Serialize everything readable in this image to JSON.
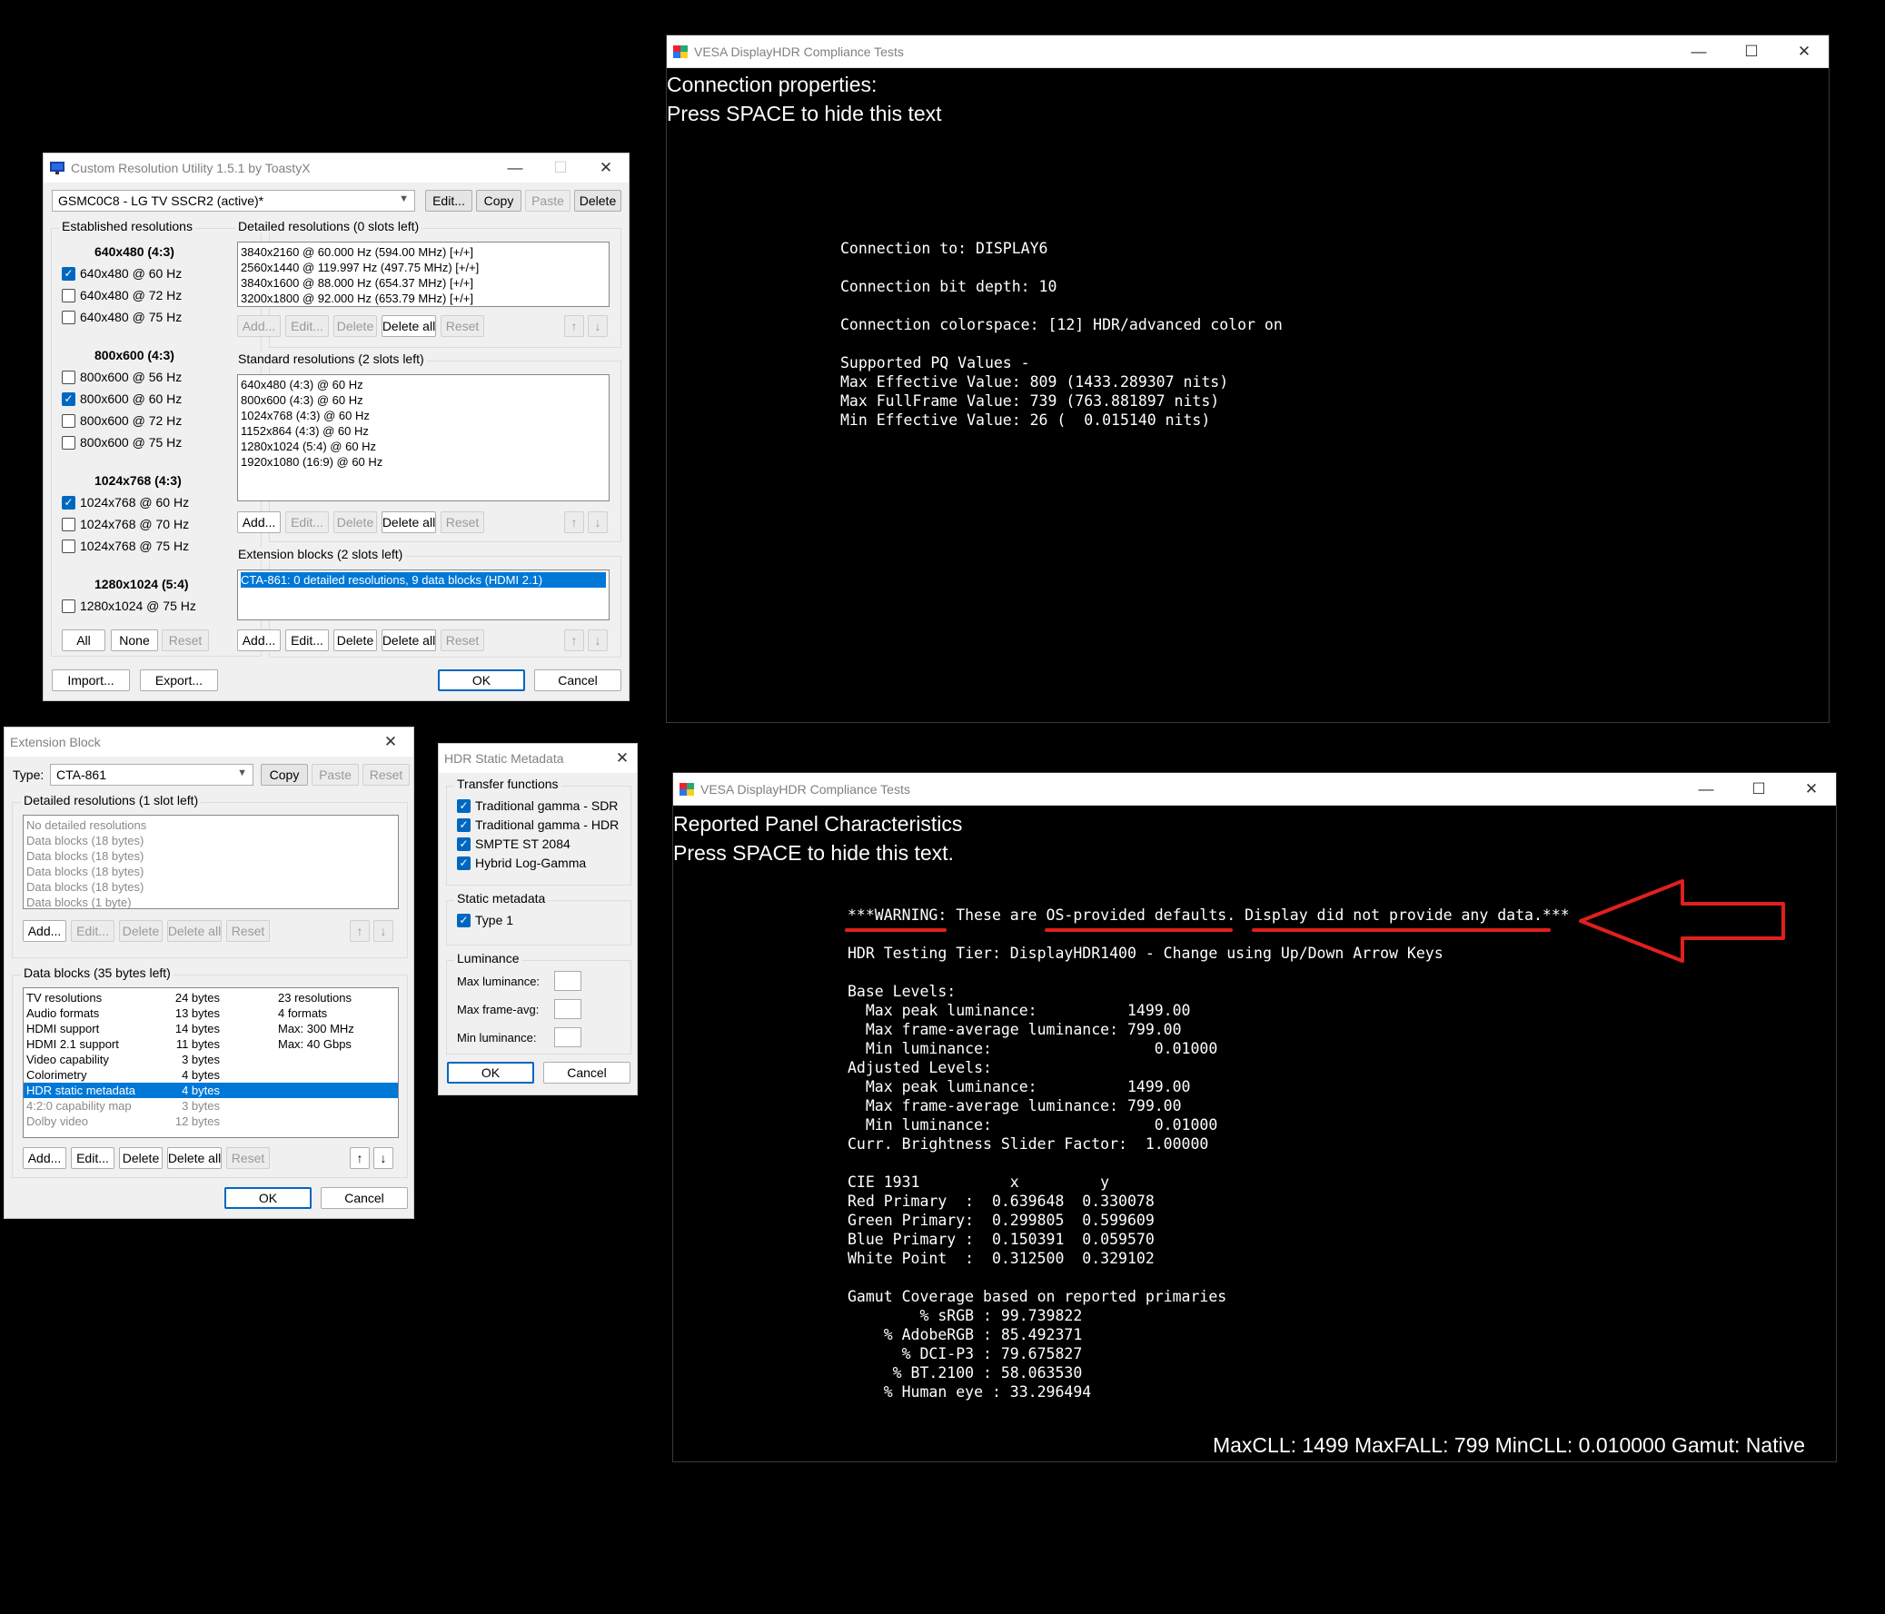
{
  "cru": {
    "title": "Custom Resolution Utility 1.5.1 by ToastyX",
    "display_select": "GSMC0C8 - LG TV SSCR2 (active)*",
    "top_buttons": {
      "edit": "Edit...",
      "copy": "Copy",
      "paste": "Paste",
      "delete": "Delete"
    },
    "established_label": "Established resolutions",
    "est_groups": [
      {
        "header": "640x480 (4:3)",
        "items": [
          {
            "label": "640x480 @ 60 Hz",
            "checked": true
          },
          {
            "label": "640x480 @ 72 Hz",
            "checked": false
          },
          {
            "label": "640x480 @ 75 Hz",
            "checked": false
          }
        ]
      },
      {
        "header": "800x600 (4:3)",
        "items": [
          {
            "label": "800x600 @ 56 Hz",
            "checked": false
          },
          {
            "label": "800x600 @ 60 Hz",
            "checked": true
          },
          {
            "label": "800x600 @ 72 Hz",
            "checked": false
          },
          {
            "label": "800x600 @ 75 Hz",
            "checked": false
          }
        ]
      },
      {
        "header": "1024x768 (4:3)",
        "items": [
          {
            "label": "1024x768 @ 60 Hz",
            "checked": true
          },
          {
            "label": "1024x768 @ 70 Hz",
            "checked": false
          },
          {
            "label": "1024x768 @ 75 Hz",
            "checked": false
          }
        ]
      },
      {
        "header": "1280x1024 (5:4)",
        "items": [
          {
            "label": "1280x1024 @ 75 Hz",
            "checked": false
          }
        ]
      }
    ],
    "est_buttons": {
      "all": "All",
      "none": "None",
      "reset": "Reset"
    },
    "detailed_label": "Detailed resolutions (0 slots left)",
    "detailed_items": [
      "3840x2160 @ 60.000 Hz (594.00 MHz) [+/+]",
      "2560x1440 @ 119.997 Hz (497.75 MHz) [+/+]",
      "3840x1600 @ 88.000 Hz (654.37 MHz) [+/+]",
      "3200x1800 @ 92.000 Hz (653.79 MHz) [+/+]"
    ],
    "standard_label": "Standard resolutions (2 slots left)",
    "standard_items": [
      "640x480 (4:3) @ 60 Hz",
      "800x600 (4:3) @ 60 Hz",
      "1024x768 (4:3) @ 60 Hz",
      "1152x864 (4:3) @ 60 Hz",
      "1280x1024 (5:4) @ 60 Hz",
      "1920x1080 (16:9) @ 60 Hz"
    ],
    "extension_label": "Extension blocks (2 slots left)",
    "extension_items": [
      "CTA-861: 0 detailed resolutions, 9 data blocks (HDMI 2.1)"
    ],
    "list_buttons": {
      "add": "Add...",
      "edit": "Edit...",
      "delete": "Delete",
      "delete_all": "Delete all",
      "reset": "Reset"
    },
    "import": "Import...",
    "export": "Export...",
    "ok": "OK",
    "cancel": "Cancel"
  },
  "ext": {
    "title": "Extension Block",
    "type_label": "Type:",
    "type_value": "CTA-861",
    "copy": "Copy",
    "paste": "Paste",
    "reset": "Reset",
    "detailed_label": "Detailed resolutions (1 slot left)",
    "detailed_items": [
      "No detailed resolutions",
      "Data blocks (18 bytes)",
      "Data blocks (18 bytes)",
      "Data blocks (18 bytes)",
      "Data blocks (18 bytes)",
      "Data blocks (1 byte)"
    ],
    "datablocks_label": "Data blocks (35 bytes left)",
    "data_rows": [
      {
        "name": "TV resolutions",
        "bytes": "24 bytes",
        "info": "23 resolutions",
        "grey": false
      },
      {
        "name": "Audio formats",
        "bytes": "13 bytes",
        "info": "4 formats",
        "grey": false
      },
      {
        "name": "HDMI support",
        "bytes": "14 bytes",
        "info": "Max: 300 MHz",
        "grey": false
      },
      {
        "name": "HDMI 2.1 support",
        "bytes": "11 bytes",
        "info": "Max: 40 Gbps",
        "grey": false
      },
      {
        "name": "Video capability",
        "bytes": "3 bytes",
        "info": "",
        "grey": false
      },
      {
        "name": "Colorimetry",
        "bytes": "4 bytes",
        "info": "",
        "grey": false
      },
      {
        "name": "HDR static metadata",
        "bytes": "4 bytes",
        "info": "",
        "grey": false,
        "selected": true
      },
      {
        "name": "4:2:0 capability map",
        "bytes": "3 bytes",
        "info": "",
        "grey": true
      },
      {
        "name": "Dolby video",
        "bytes": "12 bytes",
        "info": "",
        "grey": true
      }
    ],
    "buttons": {
      "add": "Add...",
      "edit": "Edit...",
      "delete": "Delete",
      "delete_all": "Delete all",
      "reset": "Reset"
    },
    "arrows": {
      "up": "↑",
      "down": "↓"
    },
    "ok": "OK",
    "cancel": "Cancel"
  },
  "hdr": {
    "title": "HDR Static Metadata",
    "transfer_label": "Transfer functions",
    "transfer_items": [
      {
        "label": "Traditional gamma - SDR",
        "checked": true
      },
      {
        "label": "Traditional gamma - HDR",
        "checked": true
      },
      {
        "label": "SMPTE ST 2084",
        "checked": true
      },
      {
        "label": "Hybrid Log-Gamma",
        "checked": true
      }
    ],
    "static_label": "Static metadata",
    "static_items": [
      {
        "label": "Type 1",
        "checked": true
      }
    ],
    "lum_label": "Luminance",
    "lum_fields": [
      "Max luminance:",
      "Max frame-avg:",
      "Min luminance:"
    ],
    "ok": "OK",
    "cancel": "Cancel"
  },
  "vesa1": {
    "title": "VESA DisplayHDR Compliance Tests",
    "header_lines": [
      "Connection properties:",
      "Press SPACE to hide this text"
    ],
    "body_lines": [
      "Connection to: DISPLAY6",
      "",
      "Connection bit depth: 10",
      "",
      "Connection colorspace: [12] HDR/advanced color on",
      "",
      "Supported PQ Values -",
      "Max Effective Value: 809 (1433.289307 nits)",
      "Max FullFrame Value: 739 (763.881897 nits)",
      "Min Effective Value: 26 (  0.015140 nits)"
    ]
  },
  "vesa2": {
    "title": "VESA DisplayHDR Compliance Tests",
    "header_lines": [
      "Reported Panel Characteristics",
      "Press SPACE to hide this text."
    ],
    "warning": "***WARNING: These are OS-provided defaults. Display did not provide any data.***",
    "body_lines": [
      "",
      "HDR Testing Tier: DisplayHDR1400 - Change using Up/Down Arrow Keys",
      "",
      "Base Levels:",
      "  Max peak luminance:          1499.00",
      "  Max frame-average luminance: 799.00",
      "  Min luminance:                  0.01000",
      "Adjusted Levels:",
      "  Max peak luminance:          1499.00",
      "  Max frame-average luminance: 799.00",
      "  Min luminance:                  0.01000",
      "Curr. Brightness Slider Factor:  1.00000",
      "",
      "CIE 1931          x         y",
      "Red Primary  :  0.639648  0.330078",
      "Green Primary:  0.299805  0.599609",
      "Blue Primary :  0.150391  0.059570",
      "White Point  :  0.312500  0.329102",
      "",
      "Gamut Coverage based on reported primaries",
      "        % sRGB : 99.739822",
      "    % AdobeRGB : 85.492371",
      "      % DCI-P3 : 79.675827",
      "     % BT.2100 : 58.063530",
      "    % Human eye : 33.296494"
    ],
    "footer": "MaxCLL: 1499  MaxFALL: 799  MinCLL: 0.010000  Gamut: Native"
  },
  "colors": {
    "accent": "#0067c0",
    "selection": "#0078d7",
    "annotation": "#e0201c"
  }
}
